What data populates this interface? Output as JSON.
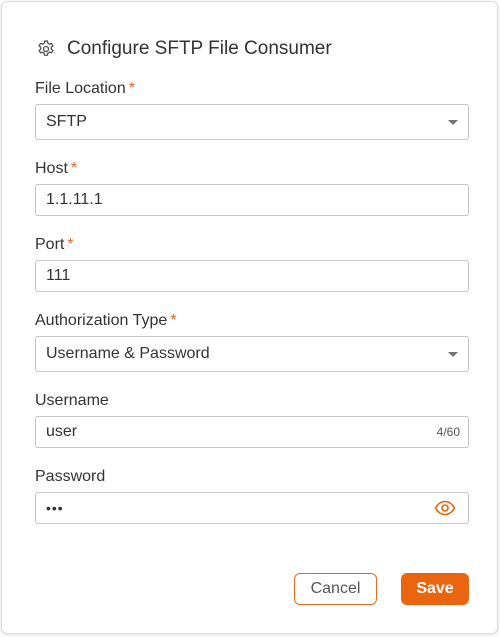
{
  "dialog": {
    "title": "Configure SFTP File Consumer",
    "icon": "gear-icon"
  },
  "colors": {
    "accent": "#E9650F",
    "required": "#E4672B",
    "border": "#C6C6C6"
  },
  "required_mark": "*",
  "fields": {
    "file_location": {
      "label": "File Location",
      "value": "SFTP"
    },
    "host": {
      "label": "Host",
      "value": "1.1.11.1"
    },
    "port": {
      "label": "Port",
      "value": "111"
    },
    "authorization_type": {
      "label": "Authorization Type",
      "value": "Username & Password"
    },
    "username": {
      "label": "Username",
      "value": "user",
      "counter": "4/60"
    },
    "password": {
      "label": "Password",
      "value": "•••"
    }
  },
  "buttons": {
    "cancel": "Cancel",
    "save": "Save"
  }
}
